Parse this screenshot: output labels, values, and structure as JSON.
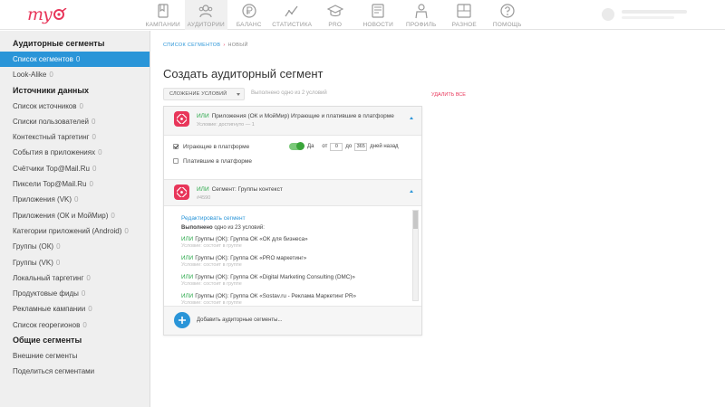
{
  "app": {
    "logo_text": "my",
    "brand_color": "#e8365a",
    "accent_color": "#2a95d8"
  },
  "topnav": {
    "items": [
      {
        "label": "КАМПАНИИ",
        "icon": "campaigns-icon"
      },
      {
        "label": "АУДИТОРИИ",
        "icon": "audiences-icon",
        "active": true
      },
      {
        "label": "БАЛАНС",
        "icon": "balance-icon"
      },
      {
        "label": "СТАТИСТИКА",
        "icon": "statistics-icon"
      },
      {
        "label": "PRO",
        "icon": "graduation-cap-icon"
      },
      {
        "label": "НОВОСТИ",
        "icon": "news-icon"
      },
      {
        "label": "ПРОФИЛЬ",
        "icon": "profile-icon"
      },
      {
        "label": "РАЗНОЕ",
        "icon": "misc-icon"
      },
      {
        "label": "ПОМОЩЬ",
        "icon": "help-icon"
      }
    ]
  },
  "sidebar": {
    "sections": [
      {
        "heading": "Аудиторные сегменты",
        "items": [
          {
            "label": "Список сегментов",
            "count": "0",
            "active": true
          },
          {
            "label": "Look-Alike",
            "count": "0"
          }
        ]
      },
      {
        "heading": "Источники данных",
        "items": [
          {
            "label": "Список источников",
            "count": "0"
          },
          {
            "label": "Списки пользователей",
            "count": "0"
          },
          {
            "label": "Контекстный таргетинг",
            "count": "0"
          },
          {
            "label": "События в приложениях",
            "count": "0"
          },
          {
            "label": "Счётчики Top@Mail.Ru",
            "count": "0"
          },
          {
            "label": "Пиксели Top@Mail.Ru",
            "count": "0"
          },
          {
            "label": "Приложения (VK)",
            "count": "0"
          },
          {
            "label": "Приложения (ОК и МойМир)",
            "count": "0"
          },
          {
            "label": "Категории приложений (Android)",
            "count": "0"
          },
          {
            "label": "Группы (ОК)",
            "count": "0"
          },
          {
            "label": "Группы (VK)",
            "count": "0"
          },
          {
            "label": "Локальный таргетинг",
            "count": "0"
          },
          {
            "label": "Продуктовые фиды",
            "count": "0"
          },
          {
            "label": "Рекламные кампании",
            "count": "0"
          },
          {
            "label": "Список георегионов",
            "count": "0"
          }
        ]
      },
      {
        "heading": "Общие сегменты",
        "items": [
          {
            "label": "Внешние сегменты",
            "count": ""
          },
          {
            "label": "Поделиться сегментами",
            "count": ""
          }
        ]
      }
    ]
  },
  "main": {
    "breadcrumb": {
      "parent": "СПИСОК СЕГМЕНТОВ",
      "separator": "›",
      "current": "НОВЫЙ"
    },
    "title": "Создать аудиторный сегмент",
    "combine_select": "СЛОЖЕНИЕ УСЛОВИЙ",
    "status": "Выполнено одно из 2 условий",
    "delete_all": "УДАЛИТЬ ВСЕ",
    "segment1": {
      "or": "ИЛИ",
      "title": "Приложения (ОК и МойМир)   Играющие и платившие в платформе",
      "subtitle": "Условие: достигнуто — 1",
      "options": [
        {
          "label": "Играющие в платформе",
          "checked": true
        },
        {
          "label": "Платившие в платформе",
          "checked": false
        }
      ],
      "toggle_label": "Да",
      "from_label": "от",
      "from_value": "0",
      "to_label": "до",
      "to_value": "365",
      "days_label": "дней назад"
    },
    "segment2": {
      "or": "ИЛИ",
      "title": "Сегмент:  Группы контекст",
      "subtitle": "#4590",
      "edit_link": "Редактировать сегмент",
      "done_bold": "Выполнено",
      "done_rest": " одно из 23 условий:",
      "conditions": [
        {
          "or": "ИЛИ",
          "title": "Группы (ОК): Группа ОК «ОК для бизнеса»",
          "sub": "Условие: состоит в группе"
        },
        {
          "or": "ИЛИ",
          "title": "Группы (ОК): Группа ОК «PRO маркетинг»",
          "sub": "Условие: состоит в группе"
        },
        {
          "or": "ИЛИ",
          "title": "Группы (ОК): Группа ОК «Digital Marketing Consulting (DMC)»",
          "sub": "Условие: состоит в группе"
        },
        {
          "or": "ИЛИ",
          "title": "Группы (ОК): Группа ОК «Sostav.ru - Реклама Маркетинг PR»",
          "sub": "Условие: состоит в группе"
        }
      ]
    },
    "add_segment_label": "Добавить аудиторные сегменты..."
  }
}
